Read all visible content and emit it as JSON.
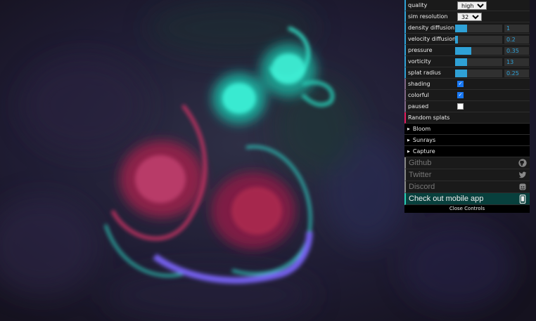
{
  "gui": {
    "quality": {
      "label": "quality",
      "value": "high"
    },
    "sim_resolution": {
      "label": "sim resolution",
      "value": "32"
    },
    "sliders": [
      {
        "label": "density diffusion",
        "value": "1",
        "fraction": 0.25
      },
      {
        "label": "velocity diffusion",
        "value": "0.2",
        "fraction": 0.06
      },
      {
        "label": "pressure",
        "value": "0.35",
        "fraction": 0.35
      },
      {
        "label": "vorticity",
        "value": "13",
        "fraction": 0.26
      },
      {
        "label": "splat radius",
        "value": "0.25",
        "fraction": 0.25
      }
    ],
    "checks": [
      {
        "label": "shading",
        "checked": true
      },
      {
        "label": "colorful",
        "checked": true
      },
      {
        "label": "paused",
        "checked": false
      }
    ],
    "random_splats": "Random splats",
    "folders": [
      "Bloom",
      "Sunrays",
      "Capture"
    ],
    "links": [
      {
        "label": "Github",
        "icon": "github-icon"
      },
      {
        "label": "Twitter",
        "icon": "twitter-icon"
      },
      {
        "label": "Discord",
        "icon": "discord-icon"
      }
    ],
    "app_link": {
      "label": "Check out mobile app",
      "icon": "mobile-phone-icon"
    },
    "close_controls": "Close Controls"
  },
  "colors": {
    "slider_fill": "#2fa1d6",
    "app_link_bg": "#08403d",
    "function_accent": "#e61d5f"
  }
}
